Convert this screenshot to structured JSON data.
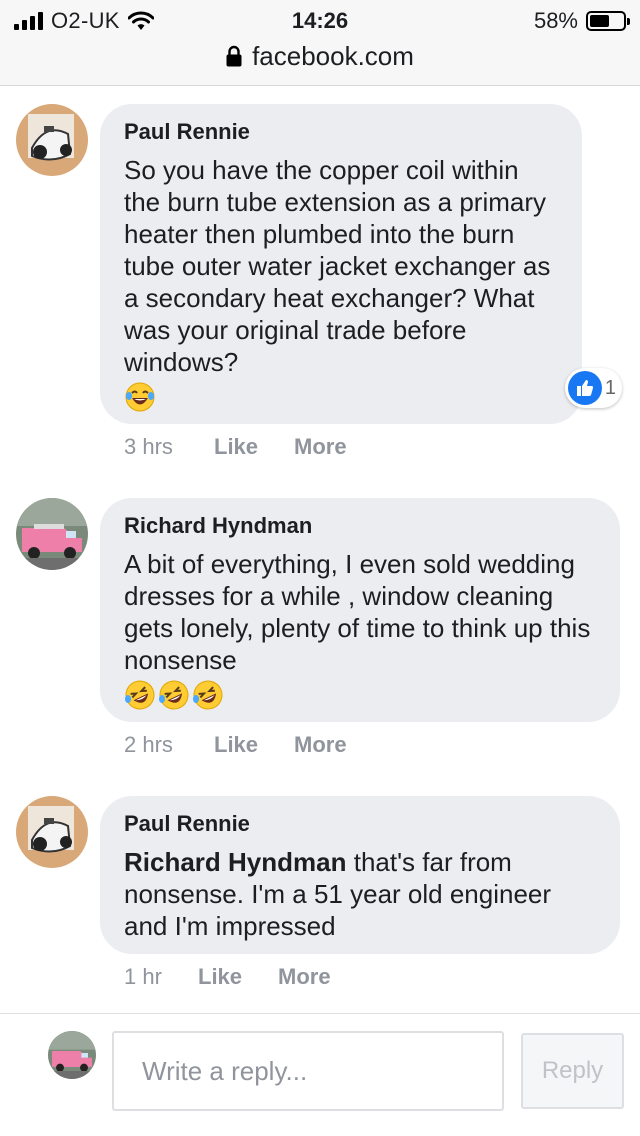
{
  "status_bar": {
    "carrier": "O2-UK",
    "time": "14:26",
    "battery": "58%",
    "battery_level": 0.58
  },
  "url_bar": {
    "domain": "facebook.com"
  },
  "comments": [
    {
      "author": "Paul Rennie",
      "text": "So you have the copper coil within the burn tube extension as a primary heater then plumbed into the burn tube outer water jacket exchanger as a secondary heat exchanger? What was your original trade before windows?",
      "emoji": [
        "😂"
      ],
      "reaction": {
        "icon": "thumbs-up-icon",
        "count": "1"
      },
      "time": "3 hrs",
      "like_label": "Like",
      "more_label": "More"
    },
    {
      "author": "Richard Hyndman",
      "text": "A bit of everything, I even sold wedding dresses for a while , window cleaning gets lonely, plenty of time to think up this nonsense",
      "emoji": [
        "🤣",
        "🤣",
        "🤣"
      ],
      "time": "2 hrs",
      "like_label": "Like",
      "more_label": "More"
    },
    {
      "author": "Paul Rennie",
      "mention": "Richard Hyndman",
      "text": " that's far from nonsense. I'm a 51 year old engineer and I'm impressed",
      "time": "1 hr",
      "like_label": "Like",
      "more_label": "More"
    }
  ],
  "composer": {
    "placeholder": "Write a reply...",
    "reply_label": "Reply"
  },
  "colors": {
    "bubble": "#ebedf0",
    "meta_text": "#90949c",
    "like_blue": "#1877f2"
  }
}
